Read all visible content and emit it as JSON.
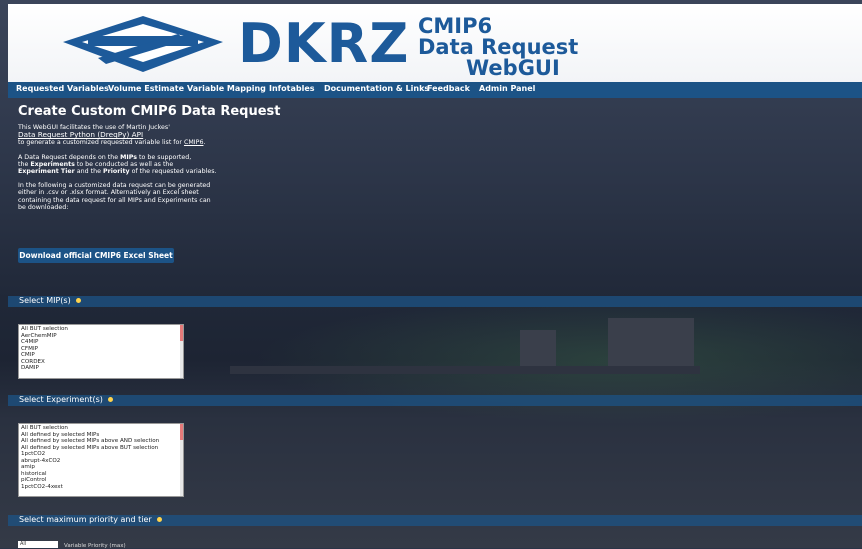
{
  "header": {
    "logo_text": "DKRZ",
    "app_title": [
      "CMIP6",
      "Data Request",
      "WebGUI"
    ]
  },
  "nav": {
    "items": [
      "Requested Variables",
      "Volume Estimate",
      "Variable Mapping",
      "Infotables",
      "Documentation & Links",
      "Feedback",
      "Admin Panel"
    ]
  },
  "main": {
    "title": "Create Custom CMIP6 Data Request",
    "intro": {
      "before": "This WebGUI facilitates the use of Martin Juckes'",
      "link": "Data Request Python (DreqPy) API",
      "after": "to generate a customized requested variable list for",
      "cmip6_link": "CMIP6",
      "period": "."
    },
    "depends": {
      "t1": "A Data Request depends on the",
      "mips": "MIPs",
      "t2": "to be supported,",
      "t3": "the",
      "experiments": "Experiments",
      "t4": "to be conducted as well as the",
      "tier": "Experiment Tier",
      "t5": "and the",
      "priority": "Priority",
      "t6": "of the requested variables."
    },
    "download_note": "In the following a customized data request can be generated either in .csv or .xlsx format. Alternatively an Excel sheet containing the data request for all MIPs and Experiments can be downloaded:",
    "download_button": "Download official CMIP6 Excel Sheet"
  },
  "sections": {
    "mips": {
      "label": "Select MIP(s)",
      "options": [
        "All BUT selection",
        "AerChemMIP",
        "C4MIP",
        "CFMIP",
        "CMIP",
        "CORDEX",
        "DAMIP"
      ]
    },
    "experiments": {
      "label": "Select Experiment(s)",
      "options": [
        "All BUT selection",
        "All defined by selected MIPs",
        "All defined by selected MIPs above AND selection",
        "All defined by selected MIPs above BUT selection",
        "1pctCO2",
        "abrupt-4xCO2",
        "amip",
        "historical",
        "piControl",
        "1pctCO2-4xext"
      ]
    },
    "priority": {
      "label": "Select maximum priority and tier",
      "input_value": "All",
      "input_label": "Variable Priority (max)"
    }
  },
  "colors": {
    "brand_blue": "#1c5386",
    "logo_blue": "#1d5a9a",
    "info_bulb": "#ffd34d"
  }
}
